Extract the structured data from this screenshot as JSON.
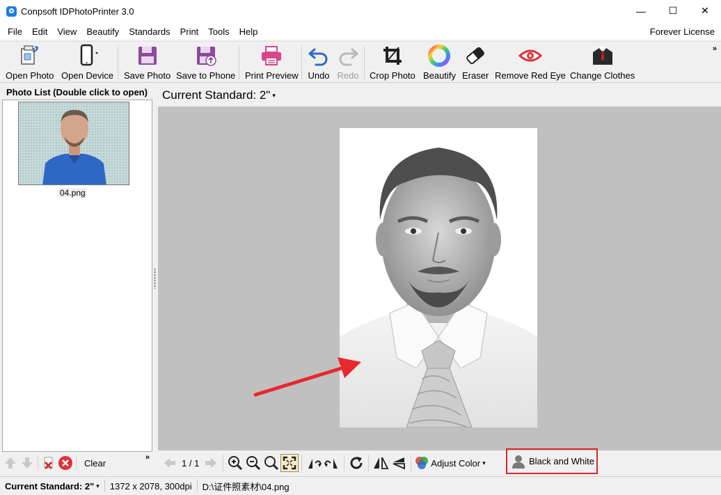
{
  "window": {
    "title": "Conpsoft IDPhotoPrinter 3.0",
    "minimize": "—",
    "maximize": "☐",
    "close": "✕"
  },
  "menu": {
    "items": [
      "File",
      "Edit",
      "View",
      "Beautify",
      "Standards",
      "Print",
      "Tools",
      "Help"
    ],
    "license": "Forever License"
  },
  "toolbar": {
    "buttons": [
      {
        "label": "Open Photo",
        "icon": "open-photo-icon"
      },
      {
        "label": "Open Device",
        "icon": "phone-device-icon"
      },
      {
        "label": "Save Photo",
        "icon": "save-icon"
      },
      {
        "label": "Save to Phone",
        "icon": "save-to-phone-icon"
      },
      {
        "label": "Print Preview",
        "icon": "printer-icon"
      },
      {
        "label": "Undo",
        "icon": "undo-icon"
      },
      {
        "label": "Redo",
        "icon": "redo-icon",
        "disabled": true
      },
      {
        "label": "Crop Photo",
        "icon": "crop-icon"
      },
      {
        "label": "Beautify",
        "icon": "color-wheel-icon"
      },
      {
        "label": "Eraser",
        "icon": "eraser-icon"
      },
      {
        "label": "Remove Red Eye",
        "icon": "red-eye-icon"
      },
      {
        "label": "Change Clothes",
        "icon": "suit-icon"
      }
    ],
    "overflow": "»"
  },
  "photo_list": {
    "title": "Photo List (Double click to open)",
    "items": [
      {
        "name": "04.png"
      }
    ],
    "clear_label": "Clear",
    "overflow": "»"
  },
  "main": {
    "current_standard": "Current Standard: 2\""
  },
  "image_toolbar": {
    "page": "1 / 1",
    "adjust_color": "Adjust Color",
    "black_and_white": "Black and White"
  },
  "status": {
    "standard": "Current Standard: 2\"",
    "size": "1372 x 2078, 300dpi",
    "path": "D:\\证件照素材\\04.png"
  },
  "colors": {
    "highlight_border": "#d9262e",
    "arrow": "#e8282e",
    "canvas_bg": "#c0c0c0",
    "accent_purple": "#8b4a9c",
    "print_pink": "#d7458c",
    "undo_blue": "#2d6ac8"
  }
}
